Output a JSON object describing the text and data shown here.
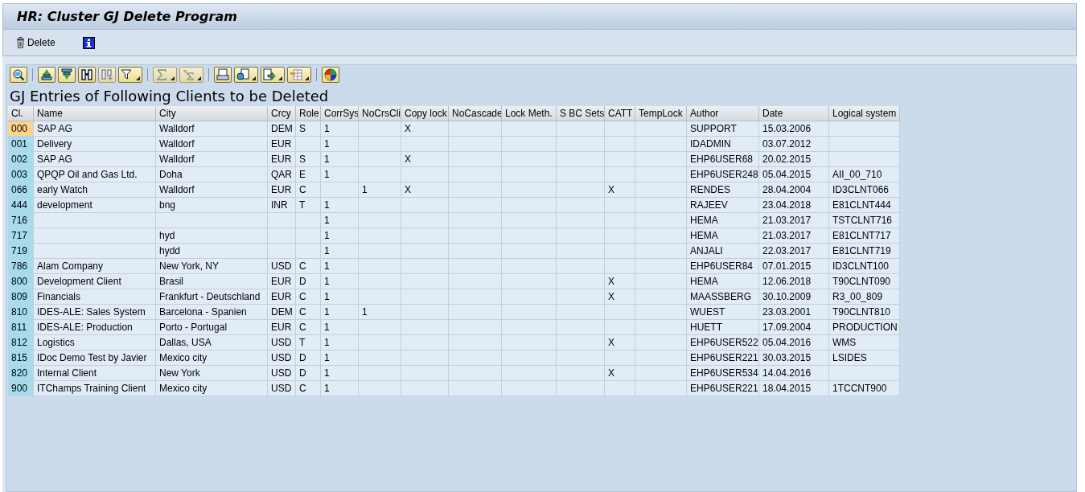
{
  "window": {
    "title": "HR: Cluster GJ Delete Program"
  },
  "app_toolbar": [
    {
      "kind": "delete",
      "label": "Delete"
    },
    {
      "kind": "info"
    }
  ],
  "alv_toolbar": [
    {
      "kind": "details",
      "dropdown": false,
      "disabled": false
    },
    {
      "kind": "sep"
    },
    {
      "kind": "sort_asc",
      "dropdown": false,
      "disabled": false
    },
    {
      "kind": "sort_desc",
      "dropdown": false,
      "disabled": false
    },
    {
      "kind": "find",
      "dropdown": false,
      "disabled": false
    },
    {
      "kind": "find_next",
      "dropdown": false,
      "disabled": true
    },
    {
      "kind": "filter",
      "dropdown": true,
      "disabled": false
    },
    {
      "kind": "sep"
    },
    {
      "kind": "total",
      "dropdown": true,
      "disabled": true
    },
    {
      "kind": "subtotal",
      "dropdown": true,
      "disabled": true
    },
    {
      "kind": "sep"
    },
    {
      "kind": "print",
      "dropdown": false,
      "disabled": false
    },
    {
      "kind": "views",
      "dropdown": true,
      "disabled": false
    },
    {
      "kind": "export",
      "dropdown": true,
      "disabled": false
    },
    {
      "kind": "layout",
      "dropdown": true,
      "disabled": false
    },
    {
      "kind": "sep"
    },
    {
      "kind": "graphic",
      "dropdown": false,
      "disabled": false
    }
  ],
  "list_title": "GJ Entries of Following Clients to be Deleted",
  "table": {
    "columns": [
      "Cl.",
      "Name",
      "City",
      "Crcy",
      "Role",
      "CorrSys",
      "NoCrsCli",
      "Copy lock",
      "NoCascade",
      "Lock Meth.",
      "S BC Sets",
      "CATT",
      "TempLock",
      "Author",
      "Date",
      "Logical system"
    ],
    "rows": [
      {
        "selected": true,
        "cells": [
          "000",
          "SAP AG",
          "Walldorf",
          "DEM",
          "S",
          "1",
          null,
          "X",
          null,
          null,
          null,
          null,
          null,
          "SUPPORT",
          "15.03.2006",
          null
        ]
      },
      {
        "selected": false,
        "cells": [
          "001",
          "Delivery",
          "Walldorf",
          "EUR",
          null,
          "1",
          null,
          null,
          null,
          null,
          null,
          null,
          null,
          "IDADMIN",
          "03.07.2012",
          null
        ]
      },
      {
        "selected": false,
        "cells": [
          "002",
          "SAP AG",
          "Walldorf",
          "EUR",
          "S",
          "1",
          null,
          "X",
          null,
          null,
          null,
          null,
          null,
          "EHP6USER68",
          "20.02.2015",
          null
        ]
      },
      {
        "selected": false,
        "cells": [
          "003",
          "QPQP Oil and Gas Ltd.",
          "Doha",
          "QAR",
          "E",
          "1",
          null,
          null,
          null,
          null,
          null,
          null,
          null,
          "EHP6USER248",
          "05.04.2015",
          "AII_00_710"
        ]
      },
      {
        "selected": false,
        "cells": [
          "066",
          "early Watch",
          "Walldorf",
          "EUR",
          "C",
          null,
          "1",
          "X",
          null,
          null,
          null,
          "X",
          null,
          "RENDES",
          "28.04.2004",
          "ID3CLNT066"
        ]
      },
      {
        "selected": false,
        "cells": [
          "444",
          "development",
          "bng",
          "INR",
          "T",
          "1",
          null,
          null,
          null,
          null,
          null,
          null,
          null,
          "RAJEEV",
          "23.04.2018",
          "E81CLNT444"
        ]
      },
      {
        "selected": false,
        "cells": [
          "716",
          null,
          null,
          null,
          null,
          "1",
          null,
          null,
          null,
          null,
          null,
          null,
          null,
          "HEMA",
          "21.03.2017",
          "TSTCLNT716"
        ]
      },
      {
        "selected": false,
        "cells": [
          "717",
          null,
          "hyd",
          null,
          null,
          "1",
          null,
          null,
          null,
          null,
          null,
          null,
          null,
          "HEMA",
          "21.03.2017",
          "E81CLNT717"
        ]
      },
      {
        "selected": false,
        "cells": [
          "719",
          null,
          "hydd",
          null,
          null,
          "1",
          null,
          null,
          null,
          null,
          null,
          null,
          null,
          "ANJALI",
          "22.03.2017",
          "E81CLNT719"
        ]
      },
      {
        "selected": false,
        "cells": [
          "786",
          "Alam Company",
          "New York, NY",
          "USD",
          "C",
          "1",
          null,
          null,
          null,
          null,
          null,
          null,
          null,
          "EHP6USER84",
          "07.01.2015",
          "ID3CLNT100"
        ]
      },
      {
        "selected": false,
        "cells": [
          "800",
          "Development Client",
          "Brasil",
          "EUR",
          "D",
          "1",
          null,
          null,
          null,
          null,
          null,
          "X",
          null,
          "HEMA",
          "12.06.2018",
          "T90CLNT090"
        ]
      },
      {
        "selected": false,
        "cells": [
          "809",
          "Financials",
          "Frankfurt - Deutschland",
          "EUR",
          "C",
          "1",
          null,
          null,
          null,
          null,
          null,
          "X",
          null,
          "MAASSBERG",
          "30.10.2009",
          "R3_00_809"
        ]
      },
      {
        "selected": false,
        "cells": [
          "810",
          "IDES-ALE: Sales System",
          "Barcelona - Spanien",
          "DEM",
          "C",
          "1",
          "1",
          null,
          null,
          null,
          null,
          null,
          null,
          "WUEST",
          "23.03.2001",
          "T90CLNT810"
        ]
      },
      {
        "selected": false,
        "cells": [
          "811",
          "IDES-ALE: Production",
          "Porto - Portugal",
          "EUR",
          "C",
          "1",
          null,
          null,
          null,
          null,
          null,
          null,
          null,
          "HUETT",
          "17.09.2004",
          "PRODUCTION"
        ]
      },
      {
        "selected": false,
        "cells": [
          "812",
          "Logistics",
          "Dallas, USA",
          "USD",
          "T",
          "1",
          null,
          null,
          null,
          null,
          null,
          "X",
          null,
          "EHP6USER522",
          "05.04.2016",
          "WMS"
        ]
      },
      {
        "selected": false,
        "cells": [
          "815",
          "IDoc Demo Test by Javier",
          "Mexico city",
          "USD",
          "D",
          "1",
          null,
          null,
          null,
          null,
          null,
          null,
          null,
          "EHP6USER221",
          "30.03.2015",
          "LSIDES"
        ]
      },
      {
        "selected": false,
        "cells": [
          "820",
          "Internal Client",
          "New York",
          "USD",
          "D",
          "1",
          null,
          null,
          null,
          null,
          null,
          "X",
          null,
          "EHP6USER534",
          "14.04.2016",
          null
        ]
      },
      {
        "selected": false,
        "cells": [
          "900",
          "ITChamps Training Client",
          "Mexico city",
          "USD",
          "C",
          "1",
          null,
          null,
          null,
          null,
          null,
          null,
          null,
          "EHP6USER221",
          "18.04.2015",
          "1TCCNT900"
        ]
      }
    ]
  }
}
